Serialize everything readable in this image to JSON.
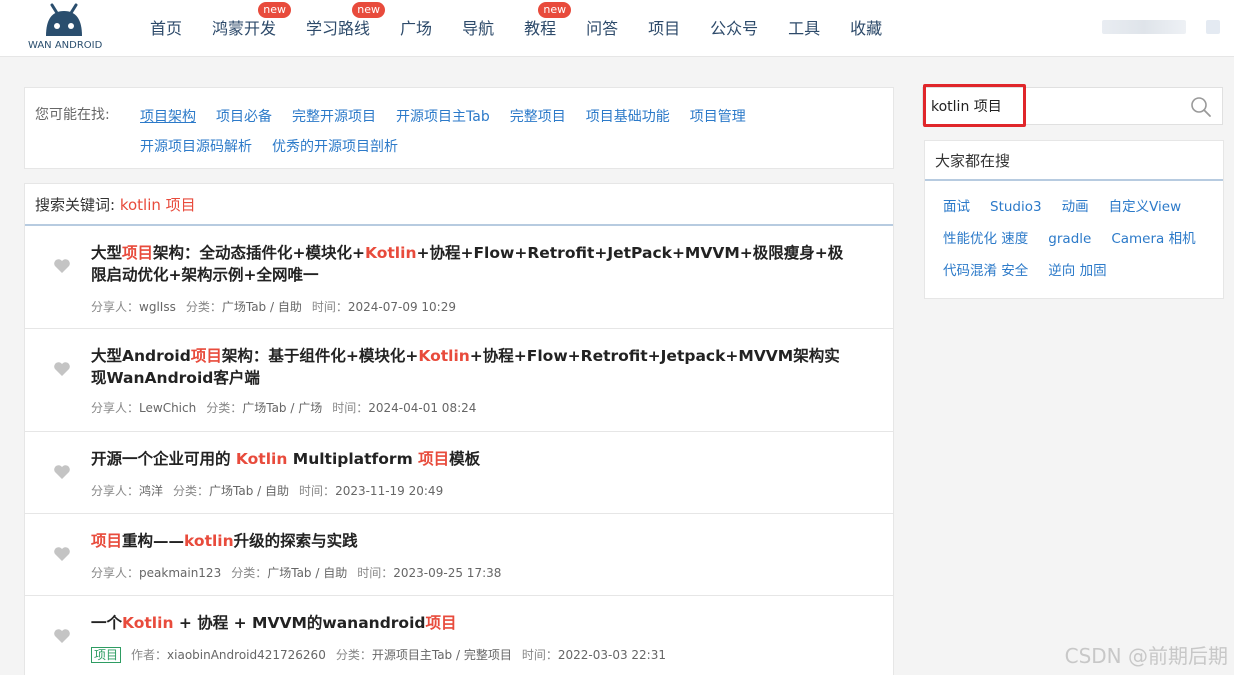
{
  "header": {
    "logo_text": "WAN ANDROID",
    "nav": [
      {
        "label": "首页",
        "badge": ""
      },
      {
        "label": "鸿蒙开发",
        "badge": "new"
      },
      {
        "label": "学习路线",
        "badge": "new"
      },
      {
        "label": "广场",
        "badge": ""
      },
      {
        "label": "导航",
        "badge": ""
      },
      {
        "label": "教程",
        "badge": "new"
      },
      {
        "label": "问答",
        "badge": ""
      },
      {
        "label": "项目",
        "badge": ""
      },
      {
        "label": "公众号",
        "badge": ""
      },
      {
        "label": "工具",
        "badge": ""
      },
      {
        "label": "收藏",
        "badge": ""
      }
    ]
  },
  "suggest": {
    "label": "您可能在找:",
    "links": [
      "项目架构",
      "项目必备",
      "完整开源项目",
      "开源项目主Tab",
      "完整项目",
      "项目基础功能",
      "项目管理",
      "开源项目源码解析",
      "优秀的开源项目剖析"
    ]
  },
  "results": {
    "head_label": "搜索关键词:",
    "keyword": "kotlin 项目",
    "items": [
      {
        "title_parts": [
          {
            "t": "大型",
            "hl": false
          },
          {
            "t": "项目",
            "hl": true
          },
          {
            "t": "架构：全动态插件化+模块化+",
            "hl": false
          },
          {
            "t": "Kotlin",
            "hl": true
          },
          {
            "t": "+协程+Flow+Retrofit+JetPack+MVVM+极限瘦身+极限启动优化+架构示例+全网唯一",
            "hl": false
          }
        ],
        "tag": "",
        "author_label": "分享人：",
        "author": "wglIss",
        "category_label": "分类：",
        "category": "广场Tab / 自助",
        "time_label": "时间：",
        "time": "2024-07-09 10:29"
      },
      {
        "title_parts": [
          {
            "t": "大型Android",
            "hl": false
          },
          {
            "t": "项目",
            "hl": true
          },
          {
            "t": "架构：基于组件化+模块化+",
            "hl": false
          },
          {
            "t": "Kotlin",
            "hl": true
          },
          {
            "t": "+协程+Flow+Retrofit+Jetpack+MVVM架构实现WanAndroid客户端",
            "hl": false
          }
        ],
        "tag": "",
        "author_label": "分享人：",
        "author": "LewChich",
        "category_label": "分类：",
        "category": "广场Tab / 广场",
        "time_label": "时间：",
        "time": "2024-04-01 08:24"
      },
      {
        "title_parts": [
          {
            "t": "开源一个企业可用的 ",
            "hl": false
          },
          {
            "t": "Kotlin",
            "hl": true
          },
          {
            "t": " Multiplatform ",
            "hl": false
          },
          {
            "t": "项目",
            "hl": true
          },
          {
            "t": "模板",
            "hl": false
          }
        ],
        "tag": "",
        "author_label": "分享人：",
        "author": "鸿洋",
        "category_label": "分类：",
        "category": "广场Tab / 自助",
        "time_label": "时间：",
        "time": "2023-11-19 20:49"
      },
      {
        "title_parts": [
          {
            "t": "项目",
            "hl": true
          },
          {
            "t": "重构——",
            "hl": false
          },
          {
            "t": "kotlin",
            "hl": true
          },
          {
            "t": "升级的探索与实践",
            "hl": false
          }
        ],
        "tag": "",
        "author_label": "分享人：",
        "author": "peakmain123",
        "category_label": "分类：",
        "category": "广场Tab / 自助",
        "time_label": "时间：",
        "time": "2023-09-25 17:38"
      },
      {
        "title_parts": [
          {
            "t": "一个",
            "hl": false
          },
          {
            "t": "Kotlin",
            "hl": true
          },
          {
            "t": " + 协程 + MVVM的wanandroid",
            "hl": false
          },
          {
            "t": "项目",
            "hl": true
          }
        ],
        "tag": "项目",
        "author_label": "作者：",
        "author": "xiaobinAndroid421726260",
        "category_label": "分类：",
        "category": "开源项目主Tab / 完整项目",
        "time_label": "时间：",
        "time": "2022-03-03 22:31"
      }
    ]
  },
  "search": {
    "value": "kotlin 项目"
  },
  "hot": {
    "title": "大家都在搜",
    "rows": [
      [
        "面试",
        "Studio3",
        "动画",
        "自定义View"
      ],
      [
        "性能优化 速度",
        "gradle",
        "Camera 相机"
      ],
      [
        "代码混淆 安全",
        "逆向 加固"
      ]
    ]
  },
  "watermark": "CSDN @前期后期",
  "colors": {
    "highlight": "#e84b3c",
    "link": "#2c7ac9",
    "nav": "#2d4a6a",
    "annotation_box": "#e0262a"
  }
}
